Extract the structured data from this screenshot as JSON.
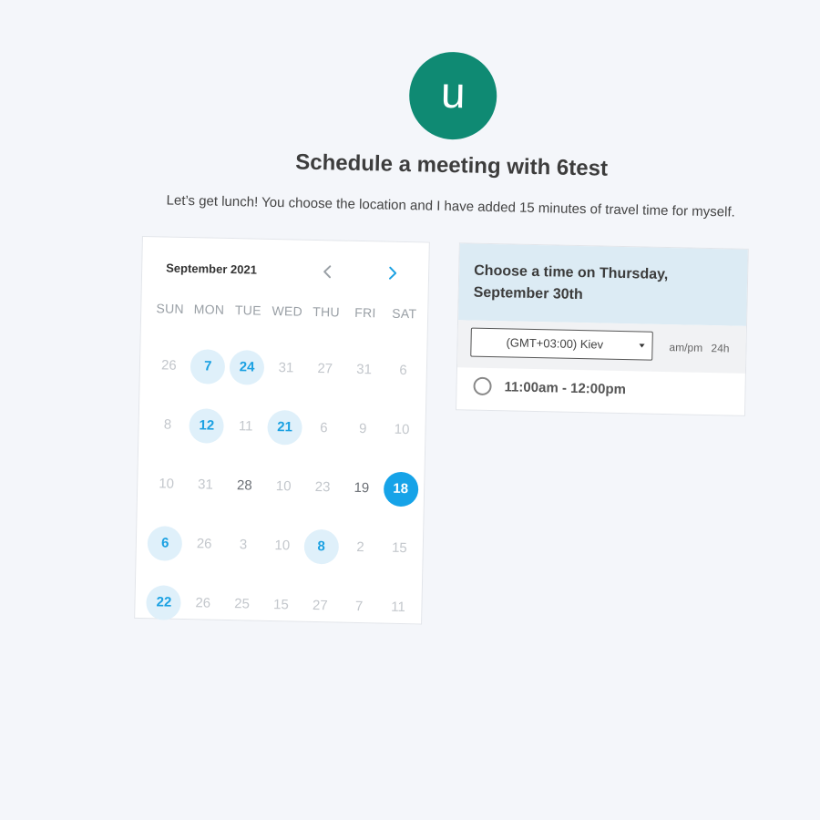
{
  "profile": {
    "avatar_letter": "u",
    "avatar_color": "#0f8a73"
  },
  "heading": {
    "title": "Schedule a meeting with 6test",
    "description": "Let’s get lunch! You choose the location and I have added 15 minutes of travel time for myself."
  },
  "calendar": {
    "month_label": "September 2021",
    "prev_icon": "chevron-left-icon",
    "next_icon": "chevron-right-icon",
    "weekdays": [
      "SUN",
      "MON",
      "TUE",
      "WED",
      "THU",
      "FRI",
      "SAT"
    ],
    "weeks": [
      [
        {
          "label": "26",
          "state": "muted"
        },
        {
          "label": "7",
          "state": "available"
        },
        {
          "label": "24",
          "state": "available"
        },
        {
          "label": "31",
          "state": "muted"
        },
        {
          "label": "27",
          "state": "muted"
        },
        {
          "label": "31",
          "state": "muted"
        },
        {
          "label": "6",
          "state": "muted"
        }
      ],
      [
        {
          "label": "8",
          "state": "muted"
        },
        {
          "label": "12",
          "state": "available"
        },
        {
          "label": "11",
          "state": "muted"
        },
        {
          "label": "21",
          "state": "available"
        },
        {
          "label": "6",
          "state": "muted"
        },
        {
          "label": "9",
          "state": "muted"
        },
        {
          "label": "10",
          "state": "muted"
        }
      ],
      [
        {
          "label": "10",
          "state": "muted"
        },
        {
          "label": "31",
          "state": "muted"
        },
        {
          "label": "28",
          "state": "plain"
        },
        {
          "label": "10",
          "state": "muted"
        },
        {
          "label": "23",
          "state": "muted"
        },
        {
          "label": "19",
          "state": "plain"
        },
        {
          "label": "18",
          "state": "selected"
        }
      ],
      [
        {
          "label": "6",
          "state": "available"
        },
        {
          "label": "26",
          "state": "muted"
        },
        {
          "label": "3",
          "state": "muted"
        },
        {
          "label": "10",
          "state": "muted"
        },
        {
          "label": "8",
          "state": "available"
        },
        {
          "label": "2",
          "state": "muted"
        },
        {
          "label": "15",
          "state": "muted"
        }
      ],
      [
        {
          "label": "22",
          "state": "available"
        },
        {
          "label": "26",
          "state": "muted"
        },
        {
          "label": "25",
          "state": "muted"
        },
        {
          "label": "15",
          "state": "muted"
        },
        {
          "label": "27",
          "state": "muted"
        },
        {
          "label": "7",
          "state": "muted"
        },
        {
          "label": "11",
          "state": "muted"
        }
      ]
    ],
    "colors": {
      "available_bg": "#dff0fa",
      "available_text": "#1ba1e2",
      "selected_bg": "#16a3e8"
    }
  },
  "times": {
    "header_line1": "Choose a time on Thursday,",
    "header_line2": "September 30th",
    "timezone": "(GMT+03:00) Kiev",
    "format_ampm": "am/pm",
    "format_24h": "24h",
    "slots": [
      {
        "label": "11:00am - 12:00pm"
      }
    ]
  }
}
